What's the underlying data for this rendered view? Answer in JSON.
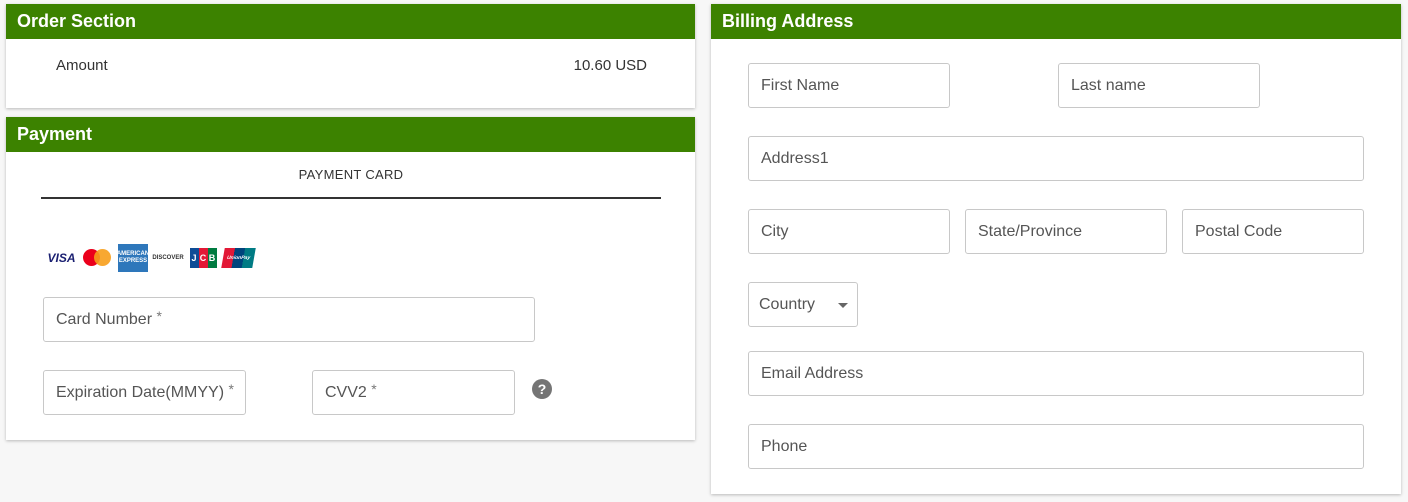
{
  "order": {
    "title": "Order Section",
    "amount_label": "Amount",
    "amount_value": "10.60 USD"
  },
  "payment": {
    "title": "Payment",
    "tab_label": "PAYMENT CARD",
    "card_logos": [
      "visa-icon",
      "mastercard-icon",
      "amex-icon",
      "discover-icon",
      "jcb-icon",
      "unionpay-icon"
    ],
    "logo_text": {
      "visa": "VISA",
      "amex": "AMERICAN EXPRESS",
      "discover": "DISCOVER",
      "jcb": [
        "J",
        "C",
        "B"
      ],
      "unionpay": "UnionPay"
    },
    "card_number_placeholder": "Card Number",
    "expiration_placeholder": "Expiration Date(MMYY)",
    "cvv_placeholder": "CVV2",
    "required_marker": "*",
    "help_icon": "?"
  },
  "billing": {
    "title": "Billing Address",
    "first_name_placeholder": "First Name",
    "last_name_placeholder": "Last name",
    "address1_placeholder": "Address1",
    "city_placeholder": "City",
    "state_placeholder": "State/Province",
    "postal_placeholder": "Postal Code",
    "country_label": "Country",
    "email_placeholder": "Email Address",
    "phone_placeholder": "Phone"
  },
  "colors": {
    "header_bg": "#3c8200",
    "header_text": "#ffffff",
    "page_bg": "#f7f7f7"
  }
}
